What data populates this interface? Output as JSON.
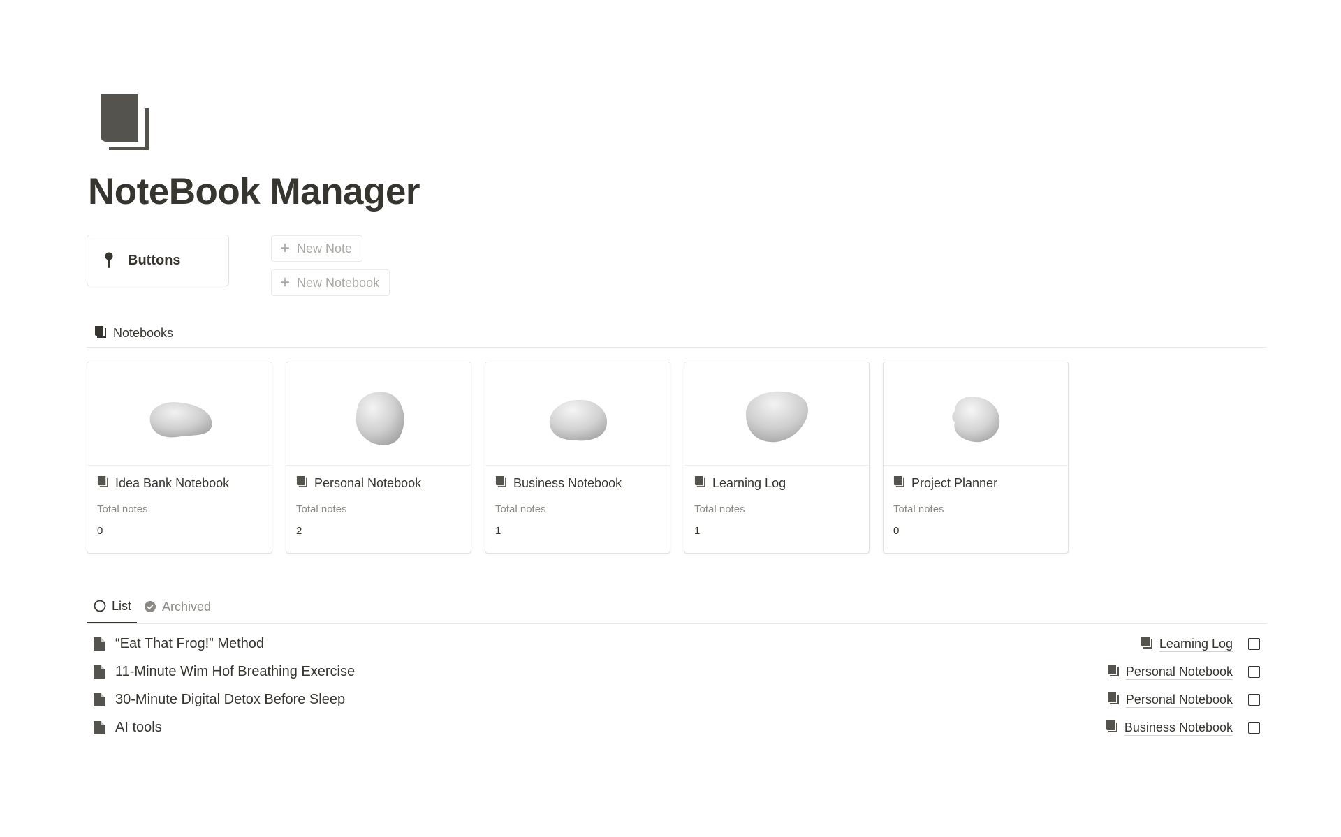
{
  "page": {
    "icon": "notebook-icon",
    "title": "NoteBook Manager"
  },
  "callout": {
    "icon": "pushpin-icon",
    "label": "Buttons"
  },
  "buttons": {
    "new_note": "New Note",
    "new_notebook": "New Notebook"
  },
  "notebooks_section": {
    "icon": "notebook-icon",
    "label": "Notebooks"
  },
  "notebooks": [
    {
      "name": "Idea Bank Notebook",
      "prop_label": "Total notes",
      "total_notes": "0"
    },
    {
      "name": "Personal Notebook",
      "prop_label": "Total notes",
      "total_notes": "2"
    },
    {
      "name": "Business Notebook",
      "prop_label": "Total notes",
      "total_notes": "1"
    },
    {
      "name": "Learning Log",
      "prop_label": "Total notes",
      "total_notes": "1"
    },
    {
      "name": "Project Planner",
      "prop_label": "Total notes",
      "total_notes": "0"
    }
  ],
  "tabs": [
    {
      "label": "List",
      "icon": "circle-icon",
      "active": true
    },
    {
      "label": "Archived",
      "icon": "check-circle-icon",
      "active": false
    }
  ],
  "notes": [
    {
      "title": "“Eat That Frog!” Method",
      "notebook": "Learning Log",
      "checked": false
    },
    {
      "title": "11-Minute Wim Hof Breathing Exercise",
      "notebook": "Personal Notebook",
      "checked": false
    },
    {
      "title": "30-Minute Digital Detox Before Sleep",
      "notebook": "Personal Notebook",
      "checked": false
    },
    {
      "title": "AI tools",
      "notebook": "Business Notebook",
      "checked": false
    }
  ],
  "colors": {
    "text": "#37352f",
    "muted": "#8a8984",
    "icon": "#55534e",
    "border": "#e3e2e0"
  }
}
